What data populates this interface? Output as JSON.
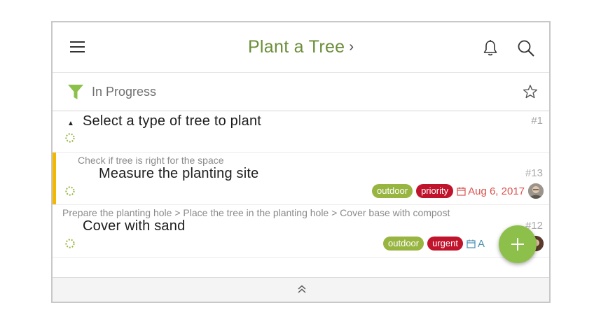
{
  "header": {
    "title": "Plant a Tree",
    "title_chevron": "›"
  },
  "filter": {
    "label": "In Progress"
  },
  "tasks": [
    {
      "breadcrumb": "",
      "name": "Select a type of tree to plant",
      "number": "#1",
      "tags": [],
      "due": ""
    },
    {
      "breadcrumb": "Check if tree is right for the space",
      "name": "Measure the planting site",
      "number": "#13",
      "tags": [
        "outdoor",
        "priority"
      ],
      "due": "Aug 6, 2017"
    },
    {
      "breadcrumb": "Prepare the planting hole > Place the tree in the planting hole > Cover base with compost",
      "name": "Cover with sand",
      "number": "#12",
      "tags": [
        "outdoor",
        "urgent"
      ],
      "due": "A"
    }
  ],
  "colors": {
    "accent": "#6b8e3a",
    "fab": "#8dc04a",
    "tag_outdoor": "#98b541",
    "tag_red": "#c0132c",
    "highlight_bar": "#f5b800",
    "due": "#d9534f"
  },
  "icons": [
    "menu-icon",
    "bell-icon",
    "search-icon",
    "filter-funnel-icon",
    "star-icon",
    "collapse-triangle-icon",
    "progress-spinner-icon",
    "calendar-icon",
    "plus-icon",
    "double-chevron-up-icon"
  ]
}
